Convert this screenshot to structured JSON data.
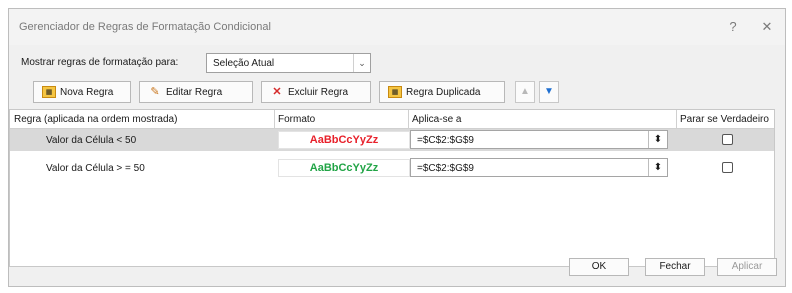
{
  "window": {
    "title": "Gerenciador de Regras de Formatação Condicional",
    "help_glyph": "?",
    "close_glyph": "✕"
  },
  "show_rules": {
    "label": "Mostrar regras de formatação para:",
    "selected": "Seleção Atual"
  },
  "toolbar": {
    "new_rule": "Nova Regra",
    "edit_rule": "Editar Regra",
    "delete_rule": "Excluir Regra",
    "duplicate_rule": "Regra Duplicada",
    "up_glyph": "▲",
    "down_glyph": "▼"
  },
  "grid": {
    "headers": {
      "rule": "Regra (aplicada na ordem mostrada)",
      "format": "Formato",
      "applies_to": "Aplica-se a",
      "stop_if_true": "Parar se Verdadeiro"
    },
    "rows": [
      {
        "rule": "Valor da Célula < 50",
        "format_preview": "AaBbCcYyZz",
        "format_color": "#e8212b",
        "applies_to": "=$C$2:$G$9",
        "stop_if_true": false,
        "selected": true
      },
      {
        "rule": "Valor da Célula > = 50",
        "format_preview": "AaBbCcYyZz",
        "format_color": "#21a446",
        "applies_to": "=$C$2:$G$9",
        "stop_if_true": false,
        "selected": false
      }
    ]
  },
  "footer": {
    "ok": "OK",
    "close": "Fechar",
    "apply": "Aplicar"
  },
  "colors": {
    "accent": "#1f6fd1"
  }
}
